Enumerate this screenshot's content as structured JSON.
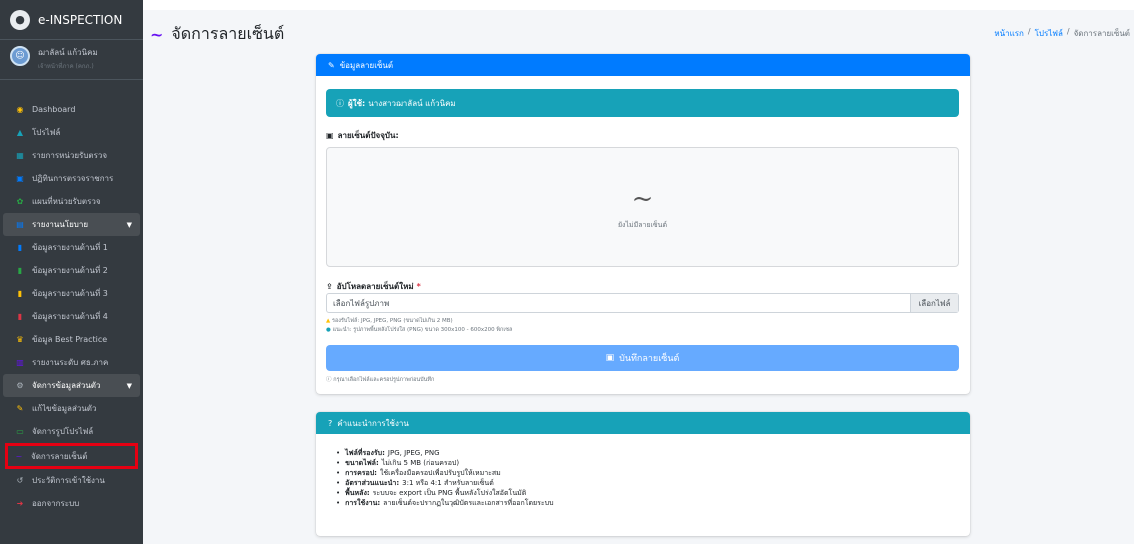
{
  "sidebar": {
    "brand": "e-INSPECTION",
    "user_name": "ฌาลัลน์ แก้วนิคม",
    "user_role": "เจ้าหน้าที่ภาค (คกภ.)",
    "items": [
      {
        "label": "Dashboard",
        "icon": "dashboard-icon",
        "color": "#ffc107"
      },
      {
        "label": "โปรไฟล์",
        "icon": "user-icon",
        "color": "#17a2b8"
      },
      {
        "label": "รายการหน่วยรับตรวจ",
        "icon": "table-icon",
        "color": "#17a2b8"
      },
      {
        "label": "ปฏิทินการตรวจราชการ",
        "icon": "calendar-icon",
        "color": "#007bff"
      },
      {
        "label": "แผนที่หน่วยรับตรวจ",
        "icon": "map-icon",
        "color": "#28a745"
      },
      {
        "label": "รายงานนโยบาย",
        "icon": "report-icon",
        "color": "#007bff"
      },
      {
        "label": "ข้อมูลรายงานด้านที่ 1",
        "icon": "file-icon",
        "color": "#007bff"
      },
      {
        "label": "ข้อมูลรายงานด้านที่ 2",
        "icon": "file-icon",
        "color": "#28a745"
      },
      {
        "label": "ข้อมูลรายงานด้านที่ 3",
        "icon": "file-icon",
        "color": "#ffc107"
      },
      {
        "label": "ข้อมูลรายงานด้านที่ 4",
        "icon": "file-icon",
        "color": "#dc3545"
      },
      {
        "label": "ข้อมูล Best Practice",
        "icon": "award-icon",
        "color": "#ffc107"
      },
      {
        "label": "รายงานระดับ ศธ.ภาค",
        "icon": "chart-icon",
        "color": "#6610f2"
      },
      {
        "label": "จัดการข้อมูลส่วนตัว",
        "icon": "cog-icon",
        "color": "#adb5bd"
      },
      {
        "label": "แก้ไขข้อมูลส่วนตัว",
        "icon": "user-edit-icon",
        "color": "#ffc107"
      },
      {
        "label": "จัดการรูปโปรไฟล์",
        "icon": "image-icon",
        "color": "#28a745"
      },
      {
        "label": "จัดการลายเซ็นต์",
        "icon": "signature-icon",
        "color": "#6610f2"
      },
      {
        "label": "ประวัติการเข้าใช้งาน",
        "icon": "history-icon",
        "color": "#adb5bd"
      },
      {
        "label": "ออกจากระบบ",
        "icon": "logout-icon",
        "color": "#dc3545"
      }
    ]
  },
  "header": {
    "title": "จัดการลายเซ็นต์",
    "breadcrumb": [
      "หน้าแรก",
      "โปรไฟล์",
      "จัดการลายเซ็นต์"
    ]
  },
  "signature_card": {
    "title": "ข้อมูลลายเซ็นต์",
    "user_label": "ผู้ใช้:",
    "user_value": "นางสาวฌาลัลน์ แก้วนิคม",
    "current_label": "ลายเซ็นต์ปัจจุบัน:",
    "empty_text": "ยังไม่มีลายเซ็นต์",
    "upload_label": "อัปโหลดลายเซ็นต์ใหม่",
    "required_mark": "*",
    "file_placeholder": "เลือกไฟล์รูปภาพ",
    "file_button": "เลือกไฟล์",
    "hint_formats": "รองรับไฟล์: JPG, JPEG, PNG (ขนาดไม่เกิน 2 MB)",
    "hint_recommend": "แนะนำ: รูปภาพพื้นหลังโปร่งใส (PNG) ขนาด 300x100 - 600x200 พิกเซล",
    "save_button": "บันทึกลายเซ็นต์",
    "save_hint": "กรุณาเลือกไฟล์และครอปรูปภาพก่อนบันทึก"
  },
  "instructions_card": {
    "title": "คำแนะนำการใช้งาน",
    "items": [
      {
        "key": "ไฟล์ที่รองรับ:",
        "value": "JPG, JPEG, PNG"
      },
      {
        "key": "ขนาดไฟล์:",
        "value": "ไม่เกิน 5 MB (ก่อนครอป)"
      },
      {
        "key": "การครอป:",
        "value": "ใช้เครื่องมือครอปเพื่อปรับรูปให้เหมาะสม"
      },
      {
        "key": "อัตราส่วนแนะนำ:",
        "value": "3:1 หรือ 4:1 สำหรับลายเซ็นต์"
      },
      {
        "key": "พื้นหลัง:",
        "value": "ระบบจะ export เป็น PNG พื้นหลังโปร่งใสอัตโนมัติ"
      },
      {
        "key": "การใช้งาน:",
        "value": "ลายเซ็นต์จะปรากฏในวุฒิบัตรและเอกสารที่ออกโดยระบบ"
      }
    ]
  }
}
